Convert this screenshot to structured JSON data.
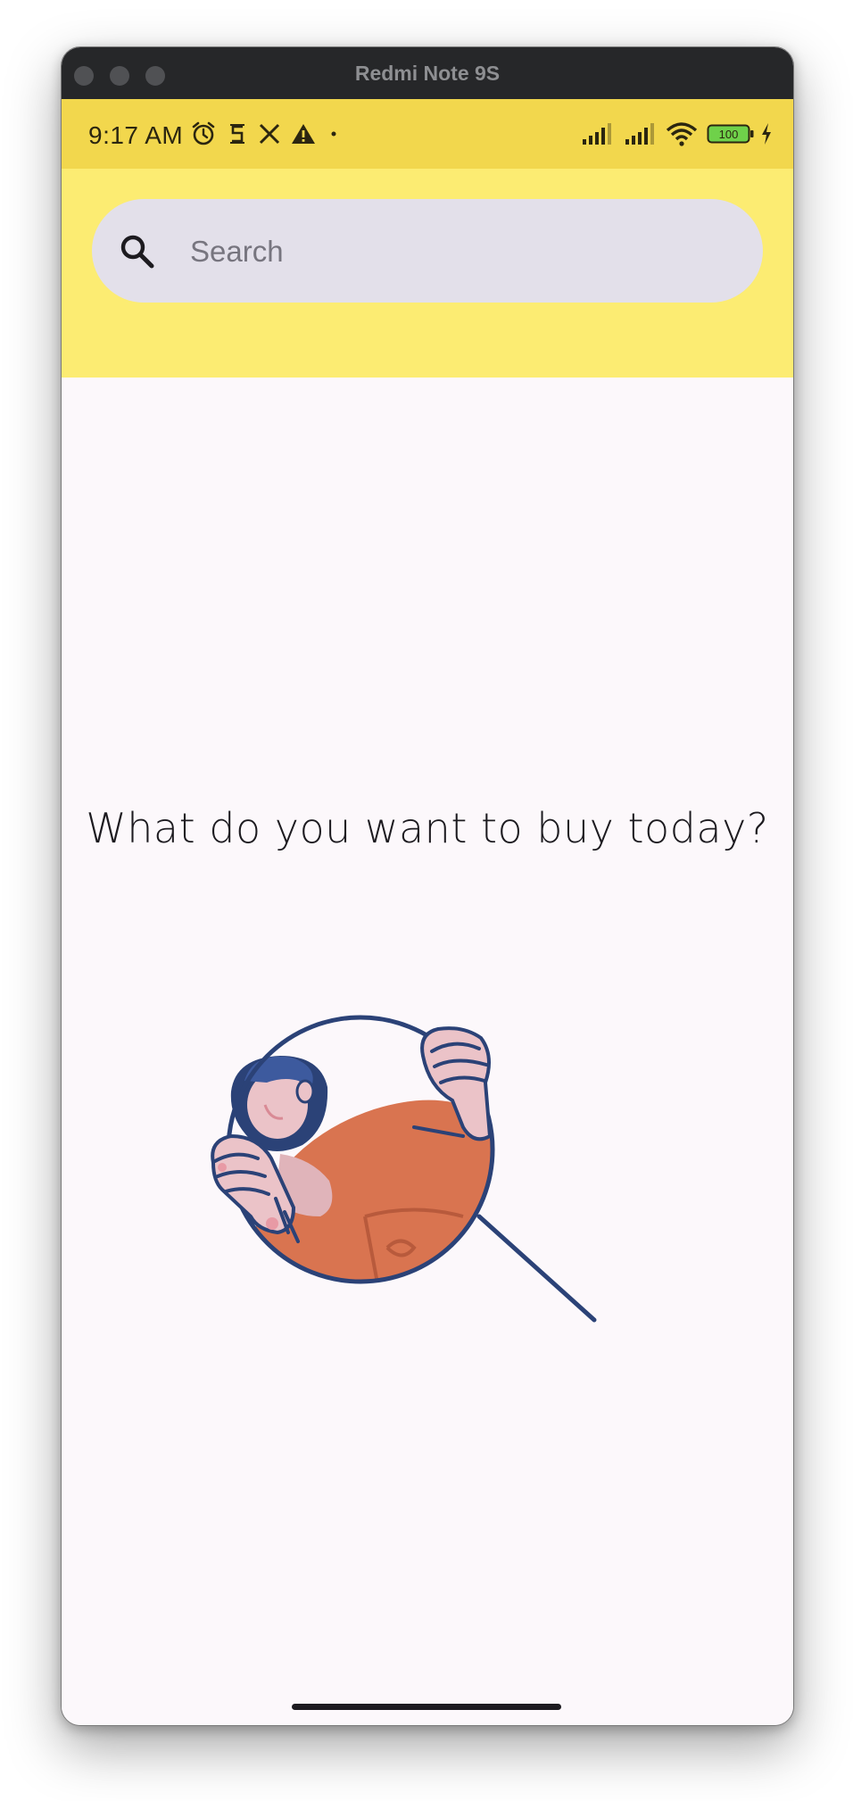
{
  "window": {
    "title": "Redmi Note 9S"
  },
  "status_bar": {
    "time": "9:17 AM",
    "battery_level": "100",
    "left_icons": [
      "alarm-icon",
      "app-s-icon",
      "x-logo-icon",
      "warning-icon",
      "dot-icon"
    ],
    "right_icons": [
      "signal-icon",
      "signal-icon",
      "wifi-icon",
      "battery-icon",
      "charging-icon"
    ]
  },
  "search": {
    "placeholder": "Search",
    "value": "",
    "icon": "search-icon"
  },
  "main": {
    "prompt": "What do you want to buy today?",
    "illustration": "person-in-magnifier-illustration"
  },
  "colors": {
    "status_bar": "#f2d74d",
    "app_bar": "#fcec72",
    "search_bg": "#e3e0ea",
    "background": "#fcf8fb",
    "illustration_orange": "#d97450",
    "illustration_navy": "#2b4277",
    "illustration_skin": "#ebc3c8"
  }
}
